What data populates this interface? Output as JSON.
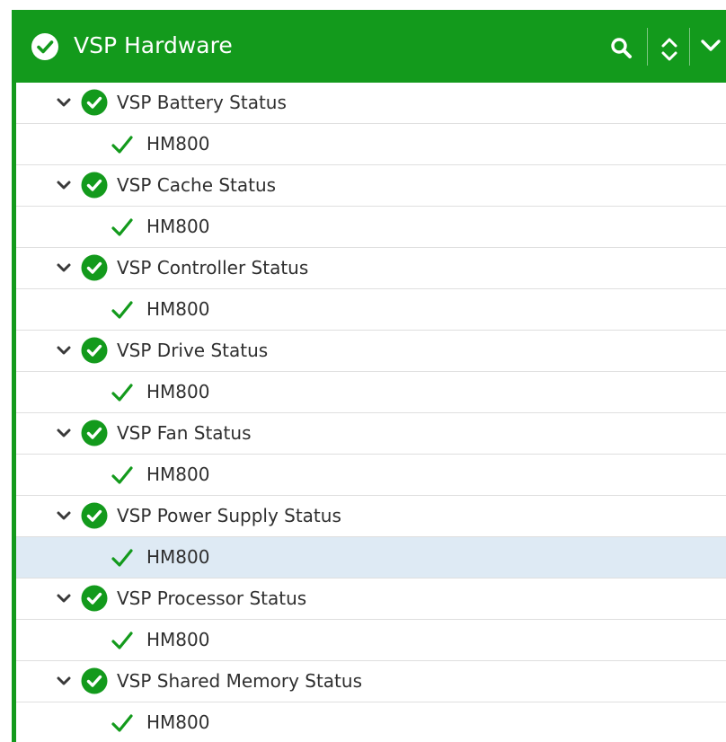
{
  "header": {
    "title": "VSP Hardware",
    "status_icon": "check-circle-icon",
    "actions": [
      "search-icon",
      "sort-icon",
      "chevron-down-icon"
    ]
  },
  "colors": {
    "brand_green": "#139a1c",
    "status_ok": "#139a1c",
    "selected_row": "#deeaf4"
  },
  "groups": [
    {
      "title": "VSP Battery Status",
      "status": "ok",
      "child": "HM800"
    },
    {
      "title": "VSP Cache Status",
      "status": "ok",
      "child": "HM800"
    },
    {
      "title": "VSP Controller Status",
      "status": "ok",
      "child": "HM800"
    },
    {
      "title": "VSP Drive Status",
      "status": "ok",
      "child": "HM800"
    },
    {
      "title": "VSP Fan Status",
      "status": "ok",
      "child": "HM800"
    },
    {
      "title": "VSP Power Supply Status",
      "status": "ok",
      "child": "HM800",
      "child_selected": true
    },
    {
      "title": "VSP Processor Status",
      "status": "ok",
      "child": "HM800"
    },
    {
      "title": "VSP Shared Memory Status",
      "status": "ok",
      "child": "HM800"
    }
  ]
}
